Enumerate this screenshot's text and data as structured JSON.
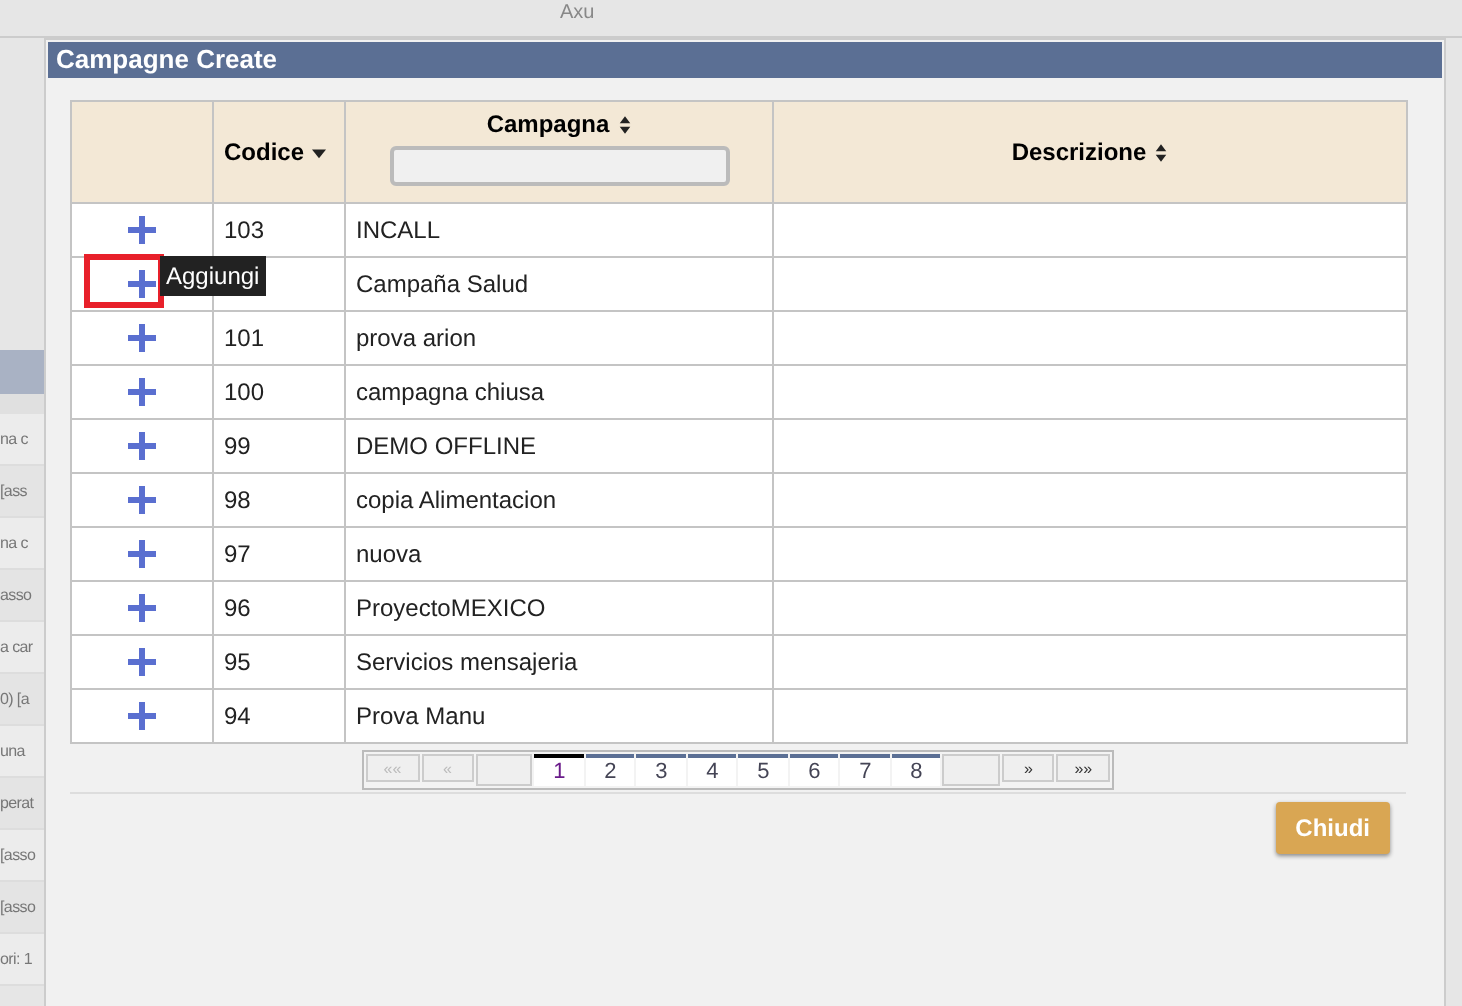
{
  "background": {
    "top_text": "Axu",
    "side_rows": [
      "na c",
      "[ass",
      "na c",
      "asso",
      "a car",
      "0) [a",
      "una",
      "perat",
      "[asso",
      "[asso",
      "ori: 1"
    ]
  },
  "dialog": {
    "title": "Campagne Create",
    "table": {
      "columns": [
        {
          "label": "Codice",
          "sorted": true,
          "kind": "plain"
        },
        {
          "label": "Campagna",
          "sorted": false,
          "kind": "filter"
        },
        {
          "label": "Descrizione",
          "sorted": false,
          "kind": "plain"
        }
      ],
      "rows": [
        {
          "code": "103",
          "name": "INCALL",
          "description": "",
          "hovered": false
        },
        {
          "code": "",
          "name": "Campaña Salud",
          "description": "",
          "hovered": true
        },
        {
          "code": "101",
          "name": "prova arion",
          "description": "",
          "hovered": false
        },
        {
          "code": "100",
          "name": "campagna chiusa",
          "description": "",
          "hovered": false
        },
        {
          "code": "99",
          "name": "DEMO OFFLINE",
          "description": "",
          "hovered": false
        },
        {
          "code": "98",
          "name": "copia Alimentacion",
          "description": "",
          "hovered": false
        },
        {
          "code": "97",
          "name": "nuova",
          "description": "",
          "hovered": false
        },
        {
          "code": "96",
          "name": "ProyectoMEXICO",
          "description": "",
          "hovered": false
        },
        {
          "code": "95",
          "name": "Servicios mensajeria",
          "description": "",
          "hovered": false
        },
        {
          "code": "94",
          "name": "Prova Manu",
          "description": "",
          "hovered": false
        }
      ]
    },
    "tooltip": "Aggiungi",
    "pager": {
      "first": "««",
      "prev": "«",
      "pages": [
        {
          "label": "1",
          "selected": true
        },
        {
          "label": "2",
          "selected": false
        },
        {
          "label": "3",
          "selected": false
        },
        {
          "label": "4",
          "selected": false
        },
        {
          "label": "5",
          "selected": false
        },
        {
          "label": "6",
          "selected": false
        },
        {
          "label": "7",
          "selected": false
        },
        {
          "label": "8",
          "selected": false
        }
      ],
      "next": "»",
      "last": "»»"
    },
    "close_button": "Chiudi"
  }
}
